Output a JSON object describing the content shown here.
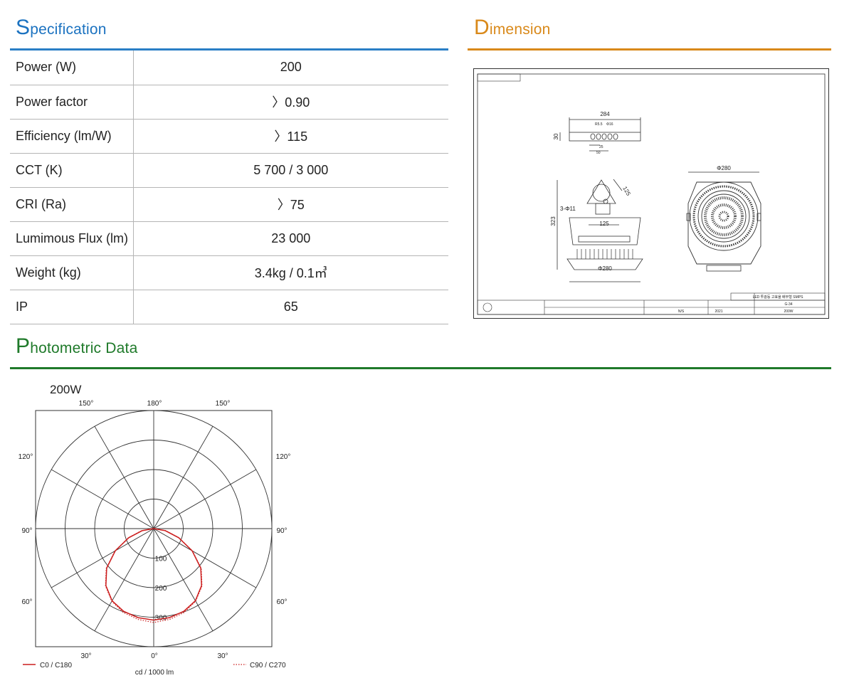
{
  "specification": {
    "title_first": "S",
    "title_rest": "pecification",
    "rows": [
      {
        "label": "Power (W)",
        "value": "200"
      },
      {
        "label": "Power factor",
        "value": "〉0.90"
      },
      {
        "label": "Efficiency (lm/W)",
        "value": "〉115"
      },
      {
        "label": "CCT (K)",
        "value": "5 700 / 3 000"
      },
      {
        "label": "CRI (Ra)",
        "value": "〉75"
      },
      {
        "label": "Lumimous Flux (lm)",
        "value": "23 000"
      },
      {
        "label": "Weight (kg)",
        "value": "3.4kg / 0.1㎥"
      },
      {
        "label": "IP",
        "value": "65"
      }
    ]
  },
  "dimension": {
    "title_first": "D",
    "title_rest": "imension",
    "drawing": {
      "bracket_length": "284",
      "bracket_height": "30",
      "bracket_r": "R5.5",
      "bracket_hole": "Φ16",
      "bracket_d1": "25",
      "bracket_d2": "50",
      "height": "323",
      "mount_size": "125",
      "mount_holes": "3-Φ11",
      "mount_width": "125",
      "diameter_side": "Φ280",
      "diameter_top": "Φ280",
      "titleblock_name": "LED 투광등 고효율 배부형 SMPS",
      "titleblock_model": "G-34",
      "titleblock_watt": "200W",
      "titleblock_year": "2021",
      "titleblock_scale": "N/S"
    }
  },
  "photometric": {
    "title_first": "P",
    "title_rest": "hotometric Data",
    "chart_name": "200W",
    "unit_label": "cd / 1000 lm",
    "legend": [
      {
        "name": "C0 / C180",
        "color": "#cc1f1f",
        "style": "solid"
      },
      {
        "name": "C90 / C270",
        "color": "#cc1f1f",
        "style": "dotted"
      }
    ]
  },
  "chart_data": {
    "type": "polar",
    "title": "200W",
    "unit": "cd / 1000 lm",
    "radial_ticks": [
      100,
      200,
      300
    ],
    "radial_max": 400,
    "angle_labels": {
      "left": [
        "150°",
        "120°",
        "90°",
        "60°",
        "30°"
      ],
      "top": "180°",
      "bottom": "0°",
      "right": [
        "150°",
        "120°",
        "90°",
        "60°",
        "30°"
      ]
    },
    "series": [
      {
        "name": "C0 / C180",
        "style": "solid",
        "color": "#cc1f1f",
        "angles": [
          0,
          10,
          20,
          30,
          40,
          50,
          60,
          70,
          80,
          90
        ],
        "values": [
          310,
          306,
          298,
          282,
          252,
          208,
          150,
          90,
          40,
          0
        ]
      },
      {
        "name": "C90 / C270",
        "style": "dotted",
        "color": "#cc1f1f",
        "angles": [
          0,
          10,
          20,
          30,
          40,
          50,
          60,
          70,
          80,
          90
        ],
        "values": [
          318,
          312,
          302,
          284,
          254,
          210,
          152,
          92,
          42,
          0
        ]
      }
    ]
  }
}
